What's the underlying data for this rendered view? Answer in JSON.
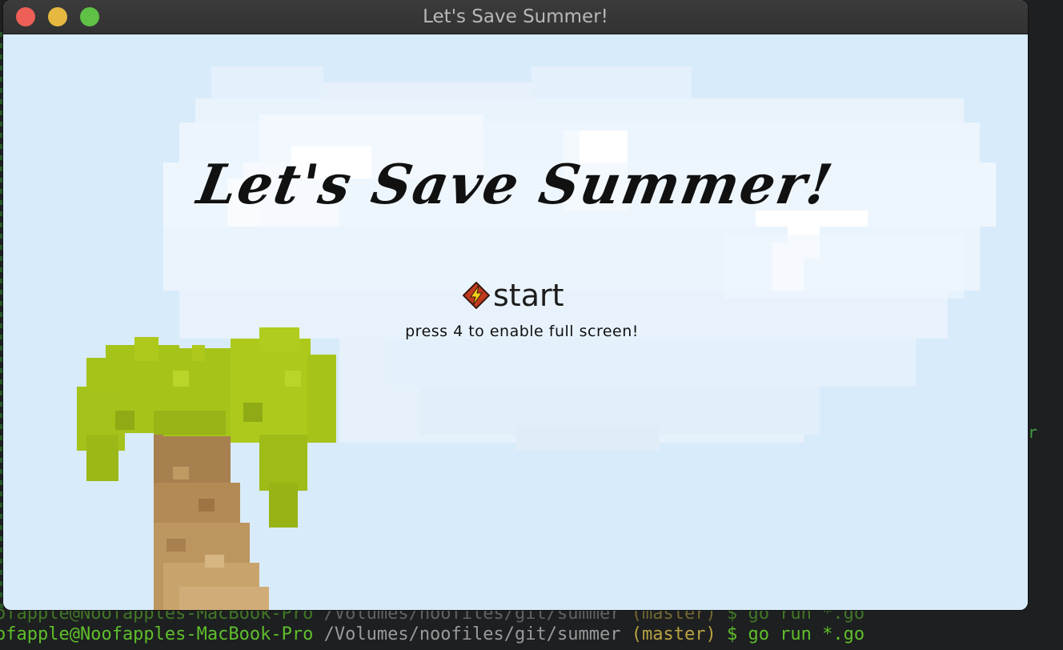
{
  "window": {
    "title": "Let's Save Summer!"
  },
  "game": {
    "title": "Let's Save Summer!",
    "menu": {
      "start_label": "start",
      "start_icon": "lightning-bolt-icon"
    },
    "hint": "press 4 to enable full screen!",
    "colors": {
      "sky": "#d8ebfa",
      "cloud": "#eef6fd",
      "palm_leaves": "#a8c81a",
      "palm_trunk": "#b8905a"
    }
  },
  "terminal": {
    "line1": {
      "user": "ofapple@Noofapples-MacBook-Pro",
      "path": "/Volumes/noofiles/git/summer",
      "branch": "(master)",
      "cmd": "$ go run *.go"
    },
    "line2": {
      "user": "ofapple@Noofapples-MacBook-Pro",
      "path": "/Volumes/noofiles/git/summer",
      "branch": "(master)",
      "cmd": "$ go run *.go"
    },
    "edge_char": "r"
  }
}
